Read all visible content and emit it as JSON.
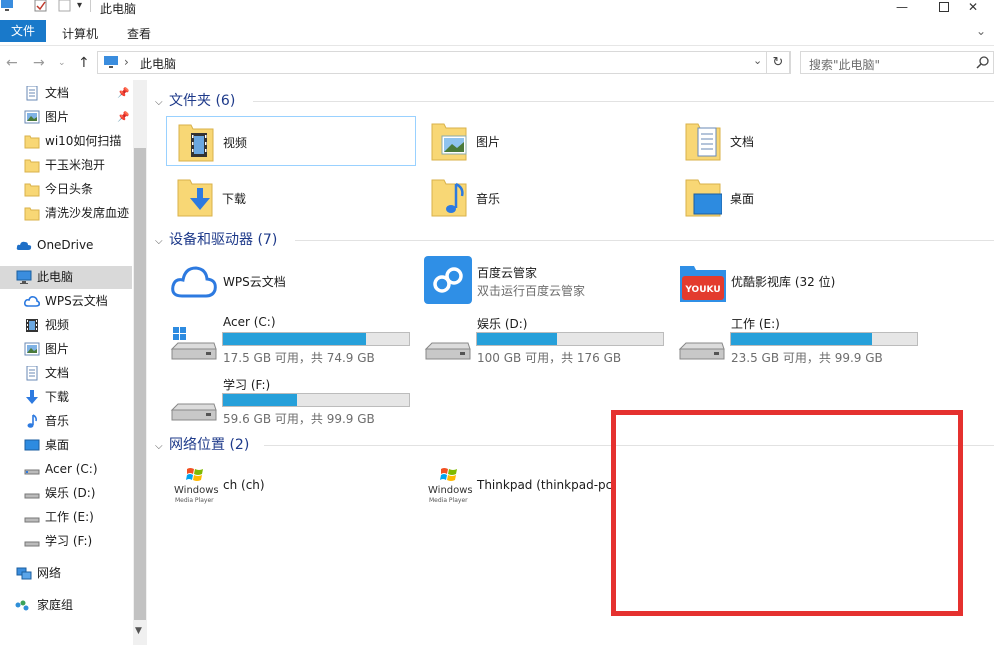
{
  "title": "此电脑",
  "ribbon": {
    "tabs": [
      "文件",
      "计算机",
      "查看"
    ]
  },
  "address": {
    "path": "此电脑",
    "separator": "›"
  },
  "search": {
    "placeholder": "搜索\"此电脑\""
  },
  "sidebar": {
    "items": [
      {
        "label": "文档",
        "icon": "document-icon",
        "pinned": true
      },
      {
        "label": "图片",
        "icon": "picture-icon",
        "pinned": true
      },
      {
        "label": "wi10如何扫描",
        "icon": "folder-icon"
      },
      {
        "label": "干玉米泡开",
        "icon": "folder-icon"
      },
      {
        "label": "今日头条",
        "icon": "folder-icon"
      },
      {
        "label": "清洗沙发席血迹",
        "icon": "folder-icon"
      },
      {
        "label": "OneDrive",
        "icon": "cloud-icon"
      },
      {
        "label": "此电脑",
        "icon": "computer-icon",
        "selected": true
      },
      {
        "label": "WPS云文档",
        "icon": "wps-cloud-icon"
      },
      {
        "label": "视频",
        "icon": "video-icon"
      },
      {
        "label": "图片",
        "icon": "picture-icon"
      },
      {
        "label": "文档",
        "icon": "document-icon"
      },
      {
        "label": "下载",
        "icon": "download-icon"
      },
      {
        "label": "音乐",
        "icon": "music-icon"
      },
      {
        "label": "桌面",
        "icon": "desktop-icon"
      },
      {
        "label": "Acer (C:)",
        "icon": "drive-icon"
      },
      {
        "label": "娱乐 (D:)",
        "icon": "drive-icon"
      },
      {
        "label": "工作 (E:)",
        "icon": "drive-icon"
      },
      {
        "label": "学习 (F:)",
        "icon": "drive-icon"
      },
      {
        "label": "网络",
        "icon": "network-icon"
      },
      {
        "label": "家庭组",
        "icon": "homegroup-icon"
      }
    ]
  },
  "groups": {
    "folders": {
      "header": "文件夹 (6)",
      "items": [
        {
          "label": "视频",
          "icon": "video-folder-icon"
        },
        {
          "label": "图片",
          "icon": "picture-folder-icon"
        },
        {
          "label": "文档",
          "icon": "document-folder-icon"
        },
        {
          "label": "下载",
          "icon": "download-folder-icon"
        },
        {
          "label": "音乐",
          "icon": "music-folder-icon"
        },
        {
          "label": "桌面",
          "icon": "desktop-folder-icon"
        }
      ]
    },
    "devices": {
      "header": "设备和驱动器 (7)",
      "apps": [
        {
          "label": "WPS云文档",
          "sub": "",
          "icon": "wps-cloud-icon"
        },
        {
          "label": "百度云管家",
          "sub": "双击运行百度云管家",
          "icon": "baidu-cloud-icon"
        },
        {
          "label": "优酷影视库 (32 位)",
          "sub": "",
          "icon": "youku-icon"
        }
      ],
      "drives": [
        {
          "label": "Acer (C:)",
          "usage": "17.5 GB 可用，共 74.9 GB",
          "used_fraction": 0.77
        },
        {
          "label": "娱乐 (D:)",
          "usage": "100 GB 可用，共 176 GB",
          "used_fraction": 0.43
        },
        {
          "label": "工作 (E:)",
          "usage": "23.5 GB 可用，共 99.9 GB",
          "used_fraction": 0.76
        },
        {
          "label": "学习 (F:)",
          "usage": "59.6 GB 可用，共 99.9 GB",
          "used_fraction": 0.4
        }
      ]
    },
    "network": {
      "header": "网络位置 (2)",
      "items": [
        {
          "label": "ch (ch)",
          "icon": "windows-media-player-icon",
          "logo_text": "Windows",
          "logo_sub": "Media Player"
        },
        {
          "label": "Thinkpad (thinkpad-pc",
          "icon": "windows-media-player-icon",
          "logo_text": "Windows",
          "logo_sub": "Media Player"
        }
      ]
    }
  },
  "colors": {
    "accent": "#1979ca",
    "group_header": "#1e3a8a",
    "drive_fill": "#26a0da",
    "highlight_box": "#e5312f",
    "folder": "#f8d775"
  }
}
